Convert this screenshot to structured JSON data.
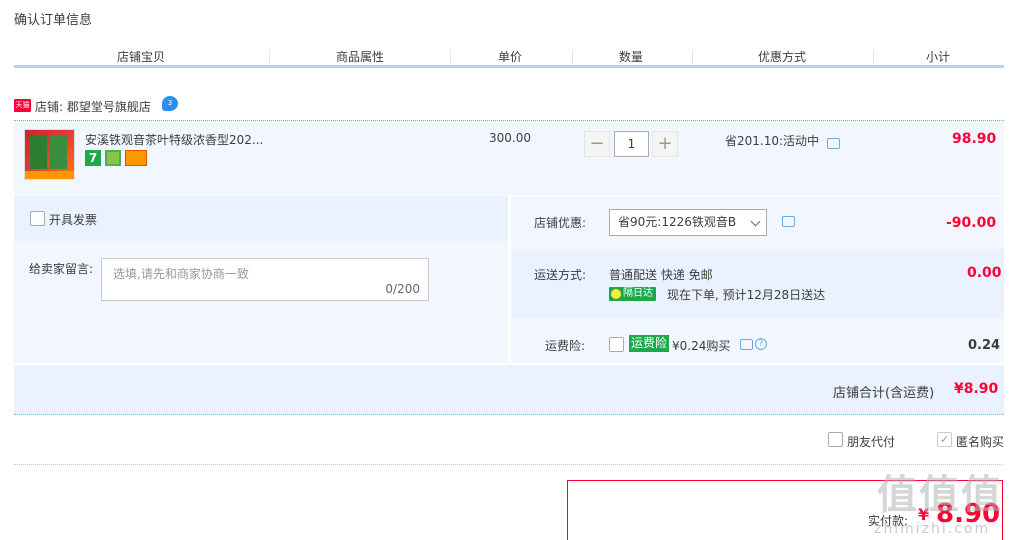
{
  "page_title": "确认订单信息",
  "columns": [
    "店铺宝贝",
    "商品属性",
    "单价",
    "数量",
    "优惠方式",
    "小计"
  ],
  "shop": {
    "badge": "天猫",
    "name": "店铺: 郡望堂号旗舰店",
    "wangwang": "3"
  },
  "item": {
    "title": "安溪铁观音茶叶特级浓香型202...",
    "badge_7": "7",
    "unit_price": "300.00",
    "quantity": "1",
    "minus": "−",
    "plus": "+",
    "promo": "省201.10:活动中",
    "subtotal": "98.90"
  },
  "invoice": {
    "label": "开具发票"
  },
  "message": {
    "label": "给卖家留言:",
    "placeholder": "选填,请先和商家协商一致",
    "count": "0/200"
  },
  "shop_discount": {
    "label": "店铺优惠:",
    "selected": "省90元:1226铁观音B",
    "value": "-90.00"
  },
  "shipping": {
    "label": "运送方式:",
    "method": "普通配送 快递 免邮",
    "badge": "隔日达",
    "eta": "现在下单, 预计12月28日送达",
    "value": "0.00"
  },
  "insurance": {
    "label": "运费险:",
    "badge": "运费险",
    "price": "¥0.24购买",
    "help": "?",
    "value": "0.24"
  },
  "shop_total": {
    "label": "店铺合计(含运费)",
    "value": "¥8.90"
  },
  "options": {
    "friend_pay": "朋友代付",
    "anonymous": "匿名购买",
    "check": "✓"
  },
  "payment": {
    "label": "实付款:",
    "symbol": "¥",
    "value": "8.90"
  },
  "watermark": {
    "main": "值值值",
    "sub": "zhimizhi.com"
  },
  "colors": {
    "accent_red": "#ff0036",
    "row_bg": "#f2f7ff",
    "header_line": "#b2d1ff",
    "green_badge": "#1ea84a"
  }
}
